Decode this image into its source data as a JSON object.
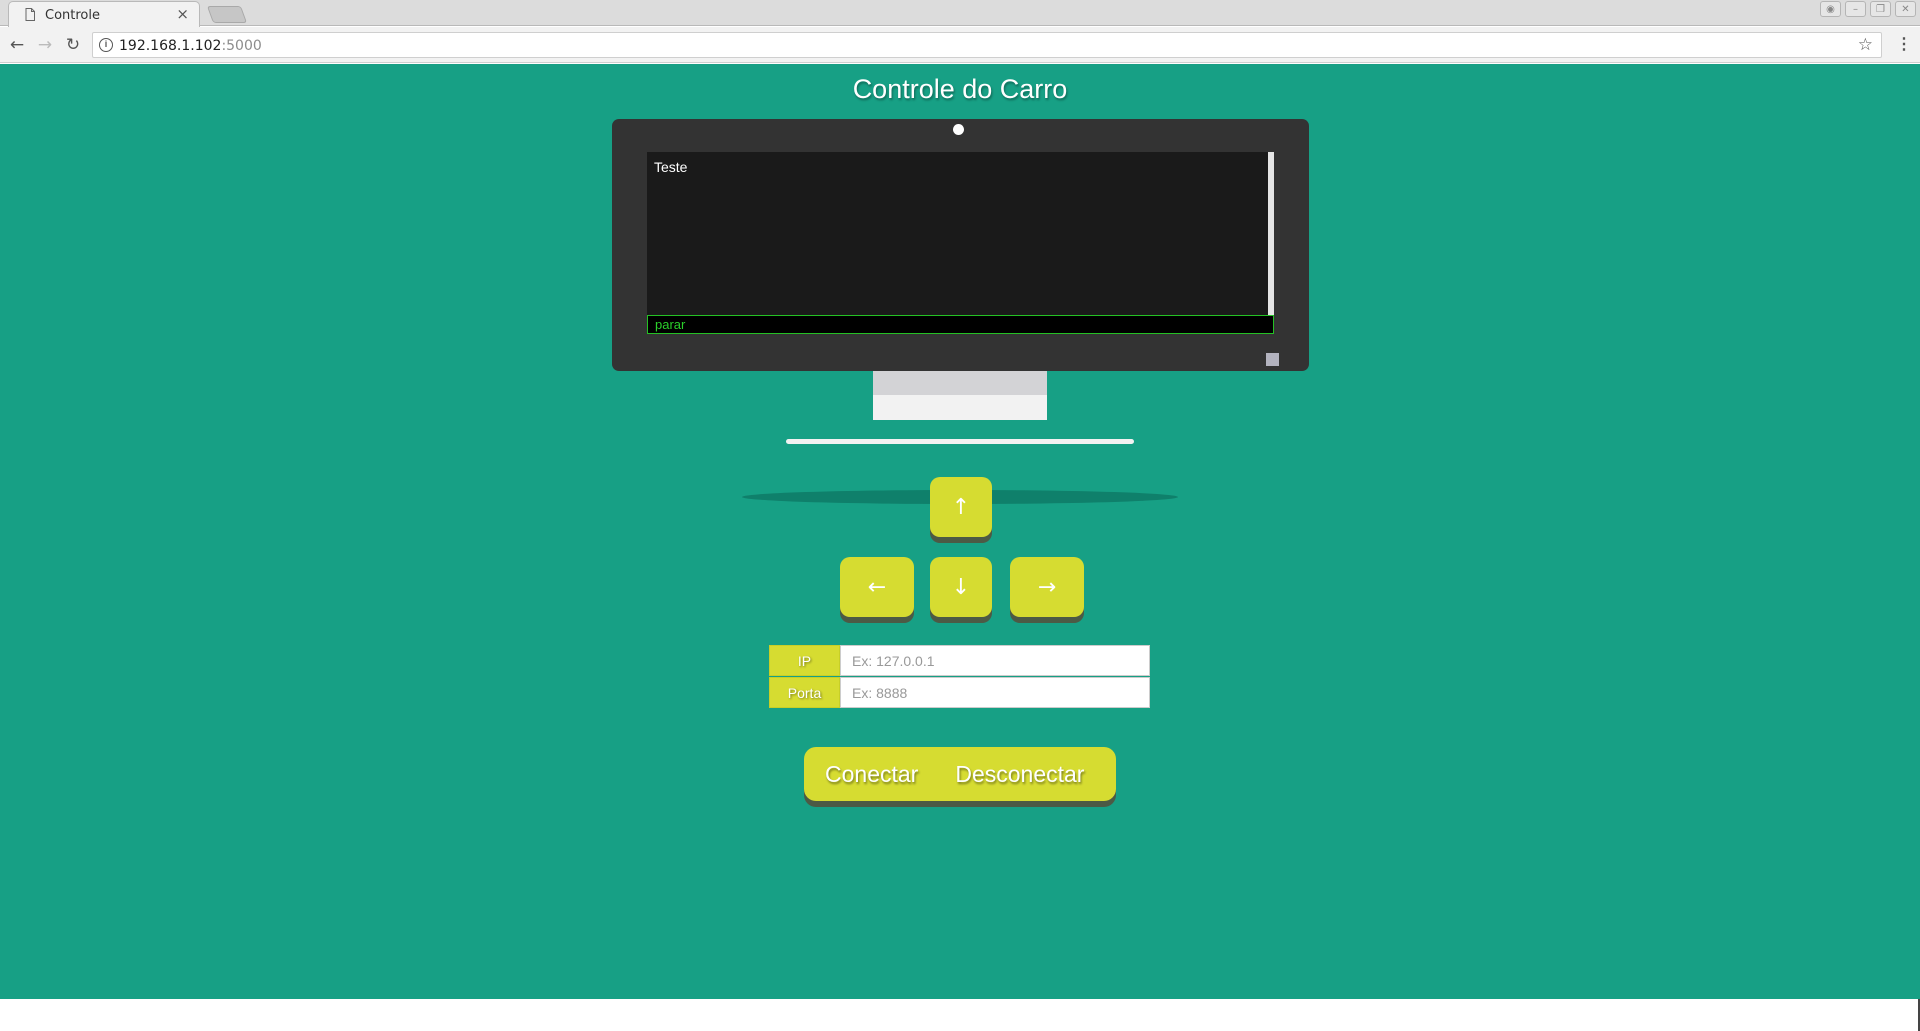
{
  "browser": {
    "tab_title": "Controle",
    "tab_close": "×",
    "url_host": "192.168.1.102",
    "url_port": ":5000",
    "back_icon": "back-arrow-icon",
    "forward_icon": "forward-arrow-icon",
    "reload_icon": "reload-icon",
    "bookmark_icon": "star-icon",
    "menu_icon": "kebab-menu-icon"
  },
  "page": {
    "title": "Controle do Carro",
    "background": "#17a085"
  },
  "monitor": {
    "output_text": "Teste",
    "command_value": "parar"
  },
  "controls": {
    "up": "↑",
    "left": "←",
    "down": "↓",
    "right": "→",
    "accent": "#d6dc31"
  },
  "connection": {
    "ip_label": "IP",
    "ip_placeholder": "Ex: 127.0.0.1",
    "port_label": "Porta",
    "port_placeholder": "Ex: 8888",
    "connect_label": "Conectar",
    "disconnect_label": "Desconectar"
  }
}
